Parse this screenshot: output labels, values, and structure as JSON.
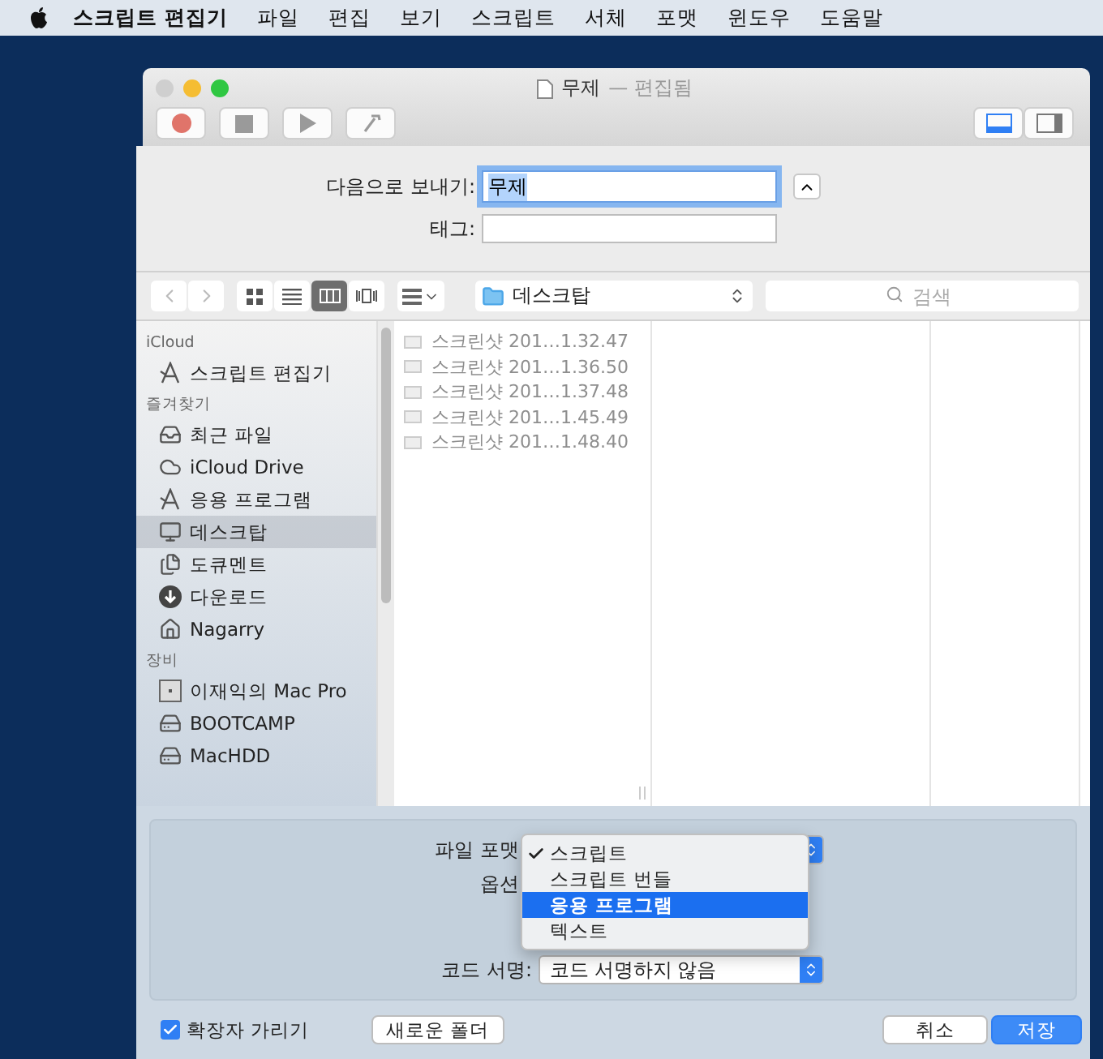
{
  "menubar": {
    "app_name": "스크립트 편집기",
    "menus": [
      "파일",
      "편집",
      "보기",
      "스크립트",
      "서체",
      "포맷",
      "윈도우",
      "도움말"
    ]
  },
  "window": {
    "title": "무제",
    "status": "— 편집됨",
    "toolbar_buttons": [
      {
        "kind": "record"
      },
      {
        "kind": "stop"
      },
      {
        "kind": "run"
      },
      {
        "kind": "compile"
      }
    ],
    "view_toggles": [
      {
        "kind": "bottom",
        "selected": true
      },
      {
        "kind": "side",
        "selected": false
      }
    ]
  },
  "save_sheet": {
    "save_as_label": "다음으로 보내기:",
    "save_as_value": "무제",
    "tags_label": "태그:",
    "view_modes": [
      {
        "kind": "icon",
        "selected": false
      },
      {
        "kind": "list",
        "selected": false
      },
      {
        "kind": "column",
        "selected": true
      },
      {
        "kind": "coverflow",
        "selected": false
      }
    ],
    "location": "데스크탑",
    "search": {
      "placeholder": "검색"
    }
  },
  "sidebar": [
    {
      "header": "iCloud",
      "items": [
        {
          "kind": "app",
          "label": "스크립트 편집기",
          "selected": false
        }
      ]
    },
    {
      "header": "즐겨찾기",
      "items": [
        {
          "kind": "recent",
          "label": "최근 파일",
          "selected": false
        },
        {
          "kind": "cloud",
          "label": "iCloud Drive",
          "selected": false
        },
        {
          "kind": "app",
          "label": "응용 프로그램",
          "selected": false
        },
        {
          "kind": "desktop",
          "label": "데스크탑",
          "selected": true
        },
        {
          "kind": "documents",
          "label": "도큐멘트",
          "selected": false
        },
        {
          "kind": "download",
          "label": "다운로드",
          "selected": false
        },
        {
          "kind": "home",
          "label": "Nagarry",
          "selected": false
        }
      ]
    },
    {
      "header": "장비",
      "items": [
        {
          "kind": "computer",
          "label": "이재익의 Mac Pro",
          "selected": false
        },
        {
          "kind": "disk",
          "label": "BOOTCAMP",
          "selected": false
        },
        {
          "kind": "disk",
          "label": "MacHDD",
          "selected": false
        }
      ]
    }
  ],
  "files": [
    {
      "name": "스크린샷 201…1.32.47",
      "disabled": true
    },
    {
      "name": "스크린샷 201…1.36.50",
      "disabled": true
    },
    {
      "name": "스크린샷 201…1.37.48",
      "disabled": true
    },
    {
      "name": "스크린샷 201…1.45.49",
      "disabled": true
    },
    {
      "name": "스크린샷 201…1.48.40",
      "disabled": true
    }
  ],
  "options": {
    "format_label": "파일 포맷",
    "options_label": "옵션",
    "format_menu": [
      {
        "label": "스크립트",
        "checked": true,
        "selected": false
      },
      {
        "label": "스크립트 번들",
        "checked": false,
        "selected": false
      },
      {
        "label": "응용 프로그램",
        "checked": false,
        "selected": true
      },
      {
        "label": "텍스트",
        "checked": false,
        "selected": false
      }
    ],
    "code_sign_label": "코드 서명:",
    "code_sign_value": "코드 서명하지 않음"
  },
  "footer": {
    "hide_extension": {
      "label": "확장자 가리기",
      "checked": true
    },
    "new_folder": "새로운 폴더",
    "cancel": "취소",
    "save": "저장"
  }
}
